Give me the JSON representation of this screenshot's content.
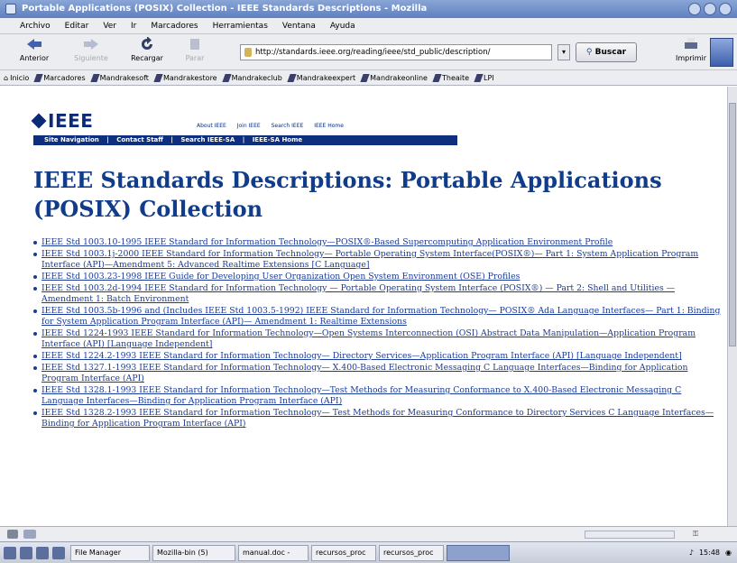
{
  "window": {
    "title": "Portable Applications (POSIX) Collection - IEEE Standards Descriptions - Mozilla"
  },
  "menu": [
    "Archivo",
    "Editar",
    "Ver",
    "Ir",
    "Marcadores",
    "Herramientas",
    "Ventana",
    "Ayuda"
  ],
  "toolbar": {
    "back": "Anterior",
    "forward": "Siguiente",
    "reload": "Recargar",
    "stop": "Parar",
    "url": "http://standards.ieee.org/reading/ieee/std_public/description/",
    "search": "Buscar",
    "print": "Imprimir"
  },
  "bookmarks": [
    "Inicio",
    "Marcadores",
    "Mandrakesoft",
    "Mandrakestore",
    "Mandrakeclub",
    "Mandrakeexpert",
    "Mandrakeonline",
    "Theaite",
    "LPI"
  ],
  "page": {
    "logo": "IEEE",
    "top_links": [
      "About IEEE",
      "Join IEEE",
      "Search IEEE",
      "IEEE Home"
    ],
    "site_nav": [
      "Site Navigation",
      "|",
      "Contact Staff",
      "|",
      "Search IEEE-SA",
      "|",
      "IEEE-SA Home"
    ],
    "heading": "IEEE Standards Descriptions: Portable Applications (POSIX) Collection",
    "standards": [
      "IEEE Std 1003.10-1995 IEEE Standard for Information Technology—POSIX®-Based Supercomputing Application Environment Profile",
      "IEEE Std 1003.1j-2000 IEEE Standard for Information Technology— Portable Operating System Interface(POSIX®)— Part 1: System Application Program Interface (API)—Amendment 5: Advanced Realtime Extensions [C Language]",
      "IEEE Std 1003.23-1998 IEEE Guide for Developing User Organization Open System Environment (OSE) Profiles",
      "IEEE Std 1003.2d-1994 IEEE Standard for Information Technology — Portable Operating System Interface (POSIX®) — Part 2: Shell and Utilities — Amendment 1: Batch Environment",
      "IEEE Std 1003.5b-1996 and (Includes IEEE Std 1003.5-1992) IEEE Standard for Information Technology— POSIX® Ada Language Interfaces— Part 1: Binding for System Application Program Interface (API)— Amendment 1: Realtime Extensions",
      "IEEE Std 1224-1993 IEEE Standard for Information Technology—Open Systems Interconnection (OSI) Abstract Data Manipulation—Application Program Interface (API) [Language Independent]",
      "IEEE Std 1224.2-1993 IEEE Standard for Information Technology— Directory Services—Application Program Interface (API) [Language Independent]",
      "IEEE Std 1327.1-1993 IEEE Standard for Information Technology— X.400-Based Electronic Messaging C Language Interfaces—Binding for Application Program Interface (API)",
      "IEEE Std 1328.1-1993 IEEE Standard for Information Technology—Test Methods for Measuring Conformance to X.400-Based Electronic Messaging C Language Interfaces—Binding for Application Program Interface (API)",
      "IEEE Std 1328.2-1993 IEEE Standard for Information Technology— Test Methods for Measuring Conformance to Directory Services C Language Interfaces—Binding for Application Program Interface (API)"
    ]
  },
  "taskbar": {
    "items": [
      "File Manager",
      "Mozilla-bin (5)",
      "manual.doc -",
      "recursos_proc",
      "recursos_proc"
    ],
    "clock": "15:48"
  }
}
